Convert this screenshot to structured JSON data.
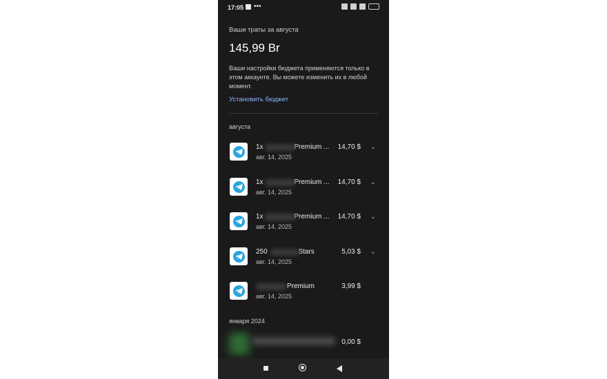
{
  "status_bar": {
    "time": "17:05",
    "dots": "•••"
  },
  "budget": {
    "title": "Ваши траты за августа",
    "amount": "145,99 Br",
    "note": "Ваши настройки бюджета применяются только в этом аккаунте. Вы можете изменить их в любой момент.",
    "set_budget_link": "Установить бюджет"
  },
  "sections": [
    {
      "label": "августа",
      "transactions": [
        {
          "title_prefix": "1x ",
          "title_suffix": "Premium ...",
          "date": "авг. 14, 2025",
          "price": "14,70 $",
          "chevron": "⌄"
        },
        {
          "title_prefix": "1x ",
          "title_suffix": "Premium ...",
          "date": "авг. 14, 2025",
          "price": "14,70 $",
          "chevron": "⌄"
        },
        {
          "title_prefix": "1x ",
          "title_suffix": "Premium ...",
          "date": "авг. 14, 2025",
          "price": "14,70 $",
          "chevron": "⌄"
        },
        {
          "title_prefix": "250 ",
          "title_suffix": "Stars",
          "date": "авг. 14, 2025",
          "price": "5,03 $",
          "chevron": "⌄"
        },
        {
          "title_prefix": "",
          "title_suffix": "Premium",
          "date": "авг. 14, 2025",
          "price": "3,99 $",
          "chevron": ""
        }
      ]
    },
    {
      "label": "января 2024",
      "transactions": [
        {
          "price": "0,00 $"
        }
      ]
    }
  ],
  "colors": {
    "background": "#1a1a1b",
    "link": "#8ab4f8",
    "telegram": "#2aa5e0"
  }
}
